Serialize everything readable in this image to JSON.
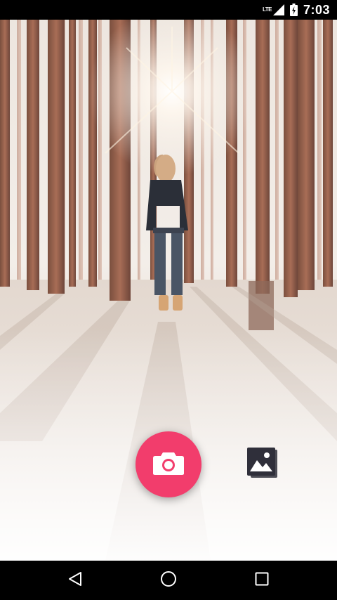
{
  "status_bar": {
    "network_type": "LTE",
    "time": "7:03",
    "icons": [
      "signal-icon",
      "battery-icon"
    ]
  },
  "main": {
    "background": "forest-photo",
    "camera_button": {
      "icon": "camera-icon",
      "color": "#f23d6c"
    },
    "gallery_button": {
      "icon": "gallery-icon",
      "color": "#2f2f3a"
    }
  },
  "nav_bar": {
    "buttons": [
      "back-icon",
      "home-icon",
      "recents-icon"
    ]
  }
}
